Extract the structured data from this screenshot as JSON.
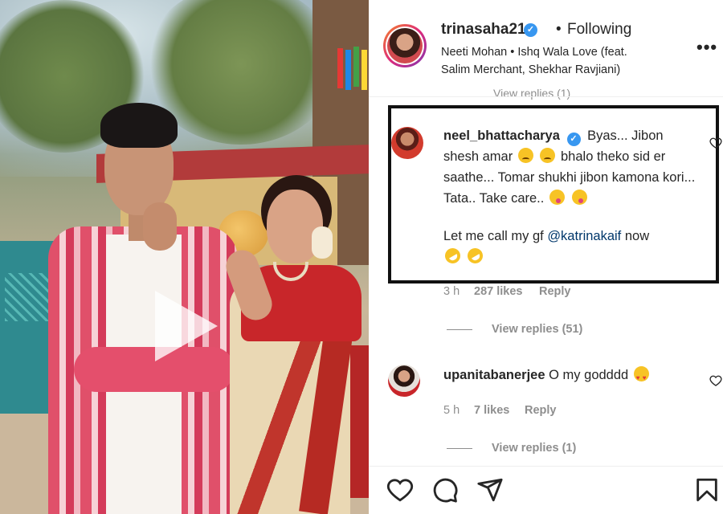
{
  "post": {
    "username": "trinasaha21",
    "separator": "•",
    "follow_state": "Following",
    "audio": "Neeti Mohan • Ishq Wala Love (feat. Salim Merchant, Shekhar Ravjiani)",
    "more_label": "•••",
    "hidden_view_replies": "View replies (1)"
  },
  "comments": [
    {
      "username": "neel_bhattacharya",
      "verified": true,
      "text_part1": "Byas... Jibon shesh amar",
      "text_part2": "bhalo theko sid er saathe... Tomar shukhi jibon kamona kori... Tata.. Take care..",
      "text_part3": "Let me call my gf",
      "mention": "@katrinakaif",
      "text_part4": "now",
      "time": "3 h",
      "likes": "287 likes",
      "reply_label": "Reply",
      "view_replies": "View replies (51)"
    },
    {
      "username": "upanitabanerjee",
      "verified": false,
      "text": "O my godddd",
      "time": "5 h",
      "likes": "7 likes",
      "reply_label": "Reply",
      "view_replies": "View replies (1)"
    }
  ],
  "icons": {
    "verified": "verified-badge-icon",
    "like": "heart-icon",
    "comment": "comment-icon",
    "share": "paper-plane-icon",
    "save": "bookmark-icon",
    "play": "play-icon"
  },
  "colors": {
    "accent": "#3897f0",
    "text": "#262626",
    "secondary": "#8e8e8e",
    "mention": "#00376b",
    "highlight_border": "#111111"
  }
}
